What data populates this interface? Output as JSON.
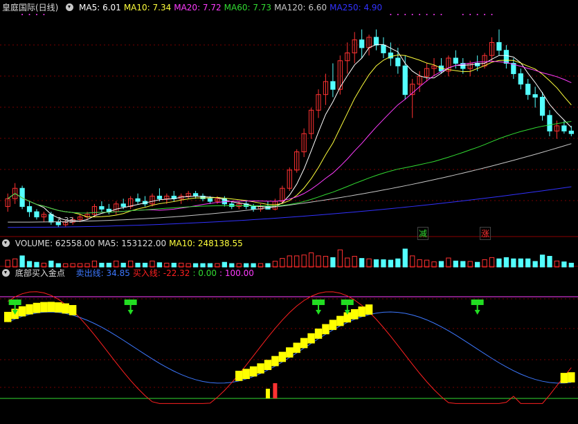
{
  "colors": {
    "background": "#000000",
    "up": "#ff3232",
    "down": "#54ffff",
    "ma5": "#ffffff",
    "ma10": "#ffff3c",
    "ma20": "#ff3cff",
    "ma60": "#32dc32",
    "ma120": "#c8c8c8",
    "ma250": "#3232ff",
    "sell_line": "#3c78ff",
    "buy_line": "#ff2020",
    "signal_bar": "#ffff00",
    "arrow": "#22dd22"
  },
  "main": {
    "title": "皇庭国际(日线)",
    "ma_labels": [
      {
        "text": "MA5: 6.01",
        "color": "#ffffff"
      },
      {
        "text": "MA10: 7.34",
        "color": "#ffff3c"
      },
      {
        "text": "MA20: 7.72",
        "color": "#ff3cff"
      },
      {
        "text": "MA60: 7.73",
        "color": "#32dc32"
      },
      {
        "text": "MA120: 6.60",
        "color": "#c8c8c8"
      },
      {
        "text": "MA250: 4.90",
        "color": "#3232ff"
      }
    ],
    "low_label": "3.33",
    "badge_reduce": "减",
    "badge_rise": "涨"
  },
  "volume": {
    "labels": [
      {
        "text": "VOLUME: 62558.00",
        "color": "#dddddd"
      },
      {
        "text": "MA5: 153122.00",
        "color": "#dddddd"
      },
      {
        "text": "MA10: 248138.55",
        "color": "#ffff3c"
      }
    ]
  },
  "indicator": {
    "title": "底部买入金点",
    "labels": [
      {
        "text": "卖出线: 34.85",
        "color": "#3c78ff"
      },
      {
        "text": "买入线: -22.32",
        "color": "#ff2020"
      },
      {
        "text": ": 0.00",
        "color": "#32dc32"
      },
      {
        "text": ": 100.00",
        "color": "#ff3cff"
      }
    ]
  },
  "chart_data": {
    "type": "candlestick",
    "title": "皇庭国际(日线)",
    "low_marker": 3.33,
    "ma_last": {
      "MA5": 6.01,
      "MA10": 7.34,
      "MA20": 7.72,
      "MA60": 7.73,
      "MA120": 6.6,
      "MA250": 4.9
    },
    "candles_ohlc": [
      [
        4.1,
        4.6,
        3.9,
        4.4
      ],
      [
        4.4,
        5.0,
        4.2,
        4.8
      ],
      [
        4.8,
        4.9,
        4.0,
        4.1
      ],
      [
        4.1,
        4.3,
        3.7,
        3.9
      ],
      [
        3.9,
        4.0,
        3.6,
        3.7
      ],
      [
        3.7,
        3.9,
        3.5,
        3.8
      ],
      [
        3.8,
        3.9,
        3.4,
        3.5
      ],
      [
        3.5,
        3.6,
        3.3,
        3.4
      ],
      [
        3.4,
        3.6,
        3.33,
        3.5
      ],
      [
        3.5,
        3.7,
        3.4,
        3.6
      ],
      [
        3.6,
        3.8,
        3.5,
        3.7
      ],
      [
        3.7,
        3.9,
        3.6,
        3.8
      ],
      [
        3.8,
        4.2,
        3.7,
        4.1
      ],
      [
        4.1,
        4.3,
        3.9,
        4.0
      ],
      [
        4.0,
        4.2,
        3.8,
        3.9
      ],
      [
        3.9,
        4.3,
        3.8,
        4.2
      ],
      [
        4.2,
        4.4,
        4.0,
        4.1
      ],
      [
        4.1,
        4.5,
        4.0,
        4.4
      ],
      [
        4.4,
        4.6,
        4.2,
        4.3
      ],
      [
        4.3,
        4.5,
        4.1,
        4.2
      ],
      [
        4.2,
        4.6,
        4.1,
        4.5
      ],
      [
        4.5,
        4.8,
        4.3,
        4.4
      ],
      [
        4.4,
        4.6,
        4.2,
        4.5
      ],
      [
        4.5,
        4.7,
        4.3,
        4.4
      ],
      [
        4.4,
        4.6,
        4.2,
        4.5
      ],
      [
        4.5,
        4.7,
        4.4,
        4.6
      ],
      [
        4.6,
        4.7,
        4.4,
        4.5
      ],
      [
        4.5,
        4.6,
        4.3,
        4.4
      ],
      [
        4.4,
        4.5,
        4.2,
        4.3
      ],
      [
        4.3,
        4.5,
        4.2,
        4.4
      ],
      [
        4.4,
        4.5,
        4.1,
        4.2
      ],
      [
        4.2,
        4.3,
        4.0,
        4.1
      ],
      [
        4.1,
        4.3,
        4.0,
        4.2
      ],
      [
        4.2,
        4.3,
        4.0,
        4.1
      ],
      [
        4.1,
        4.2,
        3.9,
        4.0
      ],
      [
        4.0,
        4.2,
        3.9,
        4.1
      ],
      [
        4.1,
        4.3,
        4.0,
        4.0
      ],
      [
        4.0,
        4.4,
        3.95,
        4.3
      ],
      [
        4.3,
        4.9,
        4.2,
        4.8
      ],
      [
        4.8,
        5.6,
        4.7,
        5.5
      ],
      [
        5.5,
        6.3,
        5.4,
        6.2
      ],
      [
        6.2,
        7.1,
        6.0,
        6.9
      ],
      [
        6.9,
        7.9,
        6.7,
        7.8
      ],
      [
        7.8,
        8.6,
        7.5,
        8.4
      ],
      [
        8.4,
        9.2,
        8.0,
        8.9
      ],
      [
        8.9,
        9.6,
        8.3,
        8.6
      ],
      [
        8.6,
        9.9,
        8.4,
        9.7
      ],
      [
        9.7,
        10.4,
        9.2,
        10.0
      ],
      [
        10.0,
        10.8,
        9.6,
        10.5
      ],
      [
        10.5,
        10.9,
        9.8,
        10.2
      ],
      [
        10.2,
        10.7,
        9.9,
        10.6
      ],
      [
        10.6,
        10.9,
        10.1,
        10.3
      ],
      [
        10.3,
        10.6,
        9.8,
        10.0
      ],
      [
        10.0,
        10.4,
        9.5,
        9.8
      ],
      [
        9.8,
        10.2,
        9.2,
        9.5
      ],
      [
        9.5,
        9.9,
        8.2,
        8.4
      ],
      [
        8.4,
        9.0,
        7.5,
        8.8
      ],
      [
        8.8,
        9.3,
        8.5,
        9.1
      ],
      [
        9.1,
        9.6,
        8.9,
        9.4
      ],
      [
        9.4,
        9.8,
        9.1,
        9.5
      ],
      [
        9.5,
        9.8,
        9.2,
        9.3
      ],
      [
        9.3,
        9.9,
        9.1,
        9.8
      ],
      [
        9.8,
        10.1,
        9.4,
        9.6
      ],
      [
        9.6,
        9.8,
        9.2,
        9.4
      ],
      [
        9.4,
        9.7,
        9.1,
        9.6
      ],
      [
        9.6,
        9.9,
        9.3,
        9.5
      ],
      [
        9.5,
        10.0,
        9.4,
        9.9
      ],
      [
        9.9,
        10.6,
        9.7,
        10.4
      ],
      [
        10.4,
        10.9,
        9.9,
        10.1
      ],
      [
        10.1,
        10.3,
        9.4,
        9.6
      ],
      [
        9.6,
        9.8,
        9.0,
        9.2
      ],
      [
        9.2,
        9.4,
        8.6,
        8.8
      ],
      [
        8.8,
        9.0,
        8.2,
        8.4
      ],
      [
        8.4,
        8.7,
        7.9,
        8.3
      ],
      [
        8.3,
        8.5,
        7.4,
        7.6
      ],
      [
        7.6,
        7.8,
        6.8,
        7.0
      ],
      [
        7.0,
        7.4,
        6.7,
        7.2
      ],
      [
        7.2,
        7.4,
        6.9,
        7.0
      ],
      [
        7.0,
        7.2,
        6.8,
        6.9
      ]
    ]
  }
}
